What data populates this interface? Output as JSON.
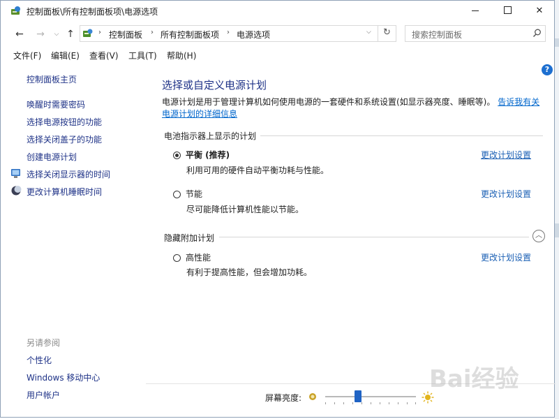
{
  "window": {
    "title": "控制面板\\所有控制面板项\\电源选项",
    "controls": {
      "minimize": "minimize",
      "maximize": "maximize",
      "close": "✕"
    }
  },
  "address": {
    "crumbs": [
      "控制面板",
      "所有控制面板项",
      "电源选项"
    ],
    "search_placeholder": "搜索控制面板"
  },
  "menu": [
    "文件(F)",
    "编辑(E)",
    "查看(V)",
    "工具(T)",
    "帮助(H)"
  ],
  "sidebar": {
    "home": "控制面板主页",
    "links": [
      "唤醒时需要密码",
      "选择电源按钮的功能",
      "选择关闭盖子的功能",
      "创建电源计划",
      "选择关闭显示器的时间",
      "更改计算机睡眠时间"
    ],
    "see_also": "另请参阅",
    "see_also_links": [
      "个性化",
      "Windows 移动中心",
      "用户帐户"
    ]
  },
  "main": {
    "title": "选择或自定义电源计划",
    "description": "电源计划是用于管理计算机如何使用电源的一套硬件和系统设置(如显示器亮度、睡眠等)。",
    "learn_more": "告诉我有关电源计划的详细信息",
    "battery_group": "电池指示器上显示的计划",
    "hidden_group": "隐藏附加计划",
    "plans": [
      {
        "name": "平衡 (推荐)",
        "desc": "利用可用的硬件自动平衡功耗与性能。",
        "link": "更改计划设置",
        "selected": true
      },
      {
        "name": "节能",
        "desc": "尽可能降低计算机性能以节能。",
        "link": "更改计划设置",
        "selected": false
      },
      {
        "name": "高性能",
        "desc": "有利于提高性能，但会增加功耗。",
        "link": "更改计划设置",
        "selected": false
      }
    ]
  },
  "brightness": {
    "label": "屏幕亮度:",
    "level": 0.35
  },
  "watermark": "Bai经验",
  "colors": {
    "link": "#1e3287",
    "accent": "#1f63c4",
    "help": "#1d6fd0"
  }
}
